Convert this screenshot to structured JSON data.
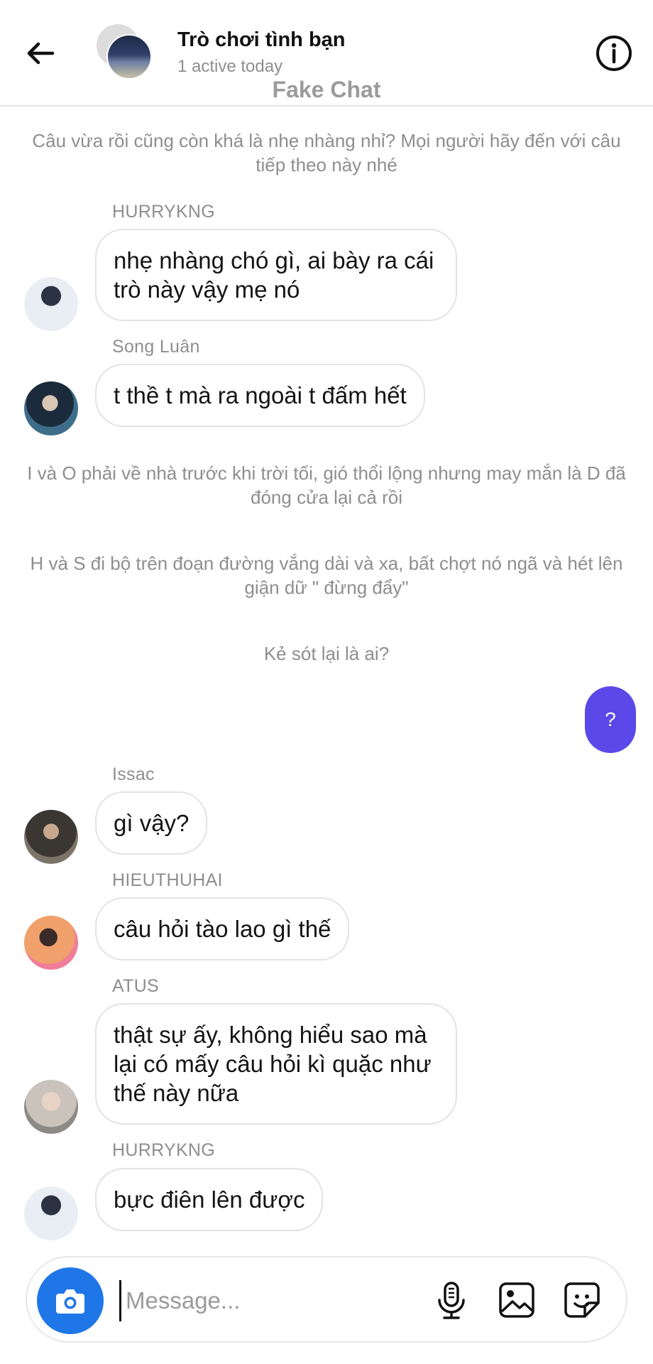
{
  "header": {
    "title": "Trò chơi tình bạn",
    "status": "1 active today",
    "watermark": "Fake Chat"
  },
  "messages": [
    {
      "type": "system",
      "text": "Câu vừa rồi cũng còn khá là nhẹ nhàng nhỉ? Mọi người hãy đến với câu tiếp theo này nhé"
    },
    {
      "type": "incoming",
      "sender": "HURRYKNG",
      "text": "nhẹ nhàng chó gì, ai bày ra cái trò này vậy mẹ nó"
    },
    {
      "type": "incoming",
      "sender": "Song Luân",
      "text": "t thề t mà ra ngoài t đấm hết"
    },
    {
      "type": "system",
      "text": "I và O phải về nhà trước khi trời tối, gió thổi lộng nhưng may mắn là D đã đóng cửa lại cả rồi"
    },
    {
      "type": "system",
      "text": "H và S đi bộ trên đoạn đường vắng dài và xa, bất chợt nó ngã và hét lên giận dữ \" đừng đẩy\""
    },
    {
      "type": "system",
      "text": "Kẻ sót lại là ai?"
    },
    {
      "type": "outgoing",
      "text": "?"
    },
    {
      "type": "incoming",
      "sender": "Issac",
      "text": "gì vậy?"
    },
    {
      "type": "incoming",
      "sender": "HIEUTHUHAI",
      "text": "câu hỏi tào lao gì thế"
    },
    {
      "type": "incoming",
      "sender": "ATUS",
      "text": "thật sự ấy, không hiểu sao mà lại có mấy câu hỏi kì quặc như thế này nữa"
    },
    {
      "type": "incoming",
      "sender": "HURRYKNG",
      "text": "bực điên lên được"
    }
  ],
  "composer": {
    "placeholder": "Message...",
    "value": ""
  },
  "icons": {
    "back": "arrow-left-icon",
    "info": "info-icon",
    "camera": "camera-icon",
    "mic": "microphone-icon",
    "gallery": "image-icon",
    "sticker": "sticker-icon"
  },
  "colors": {
    "outgoing_bubble": "#5a49e8",
    "camera_button": "#1f76e6",
    "muted_text": "#8e8e8e"
  }
}
